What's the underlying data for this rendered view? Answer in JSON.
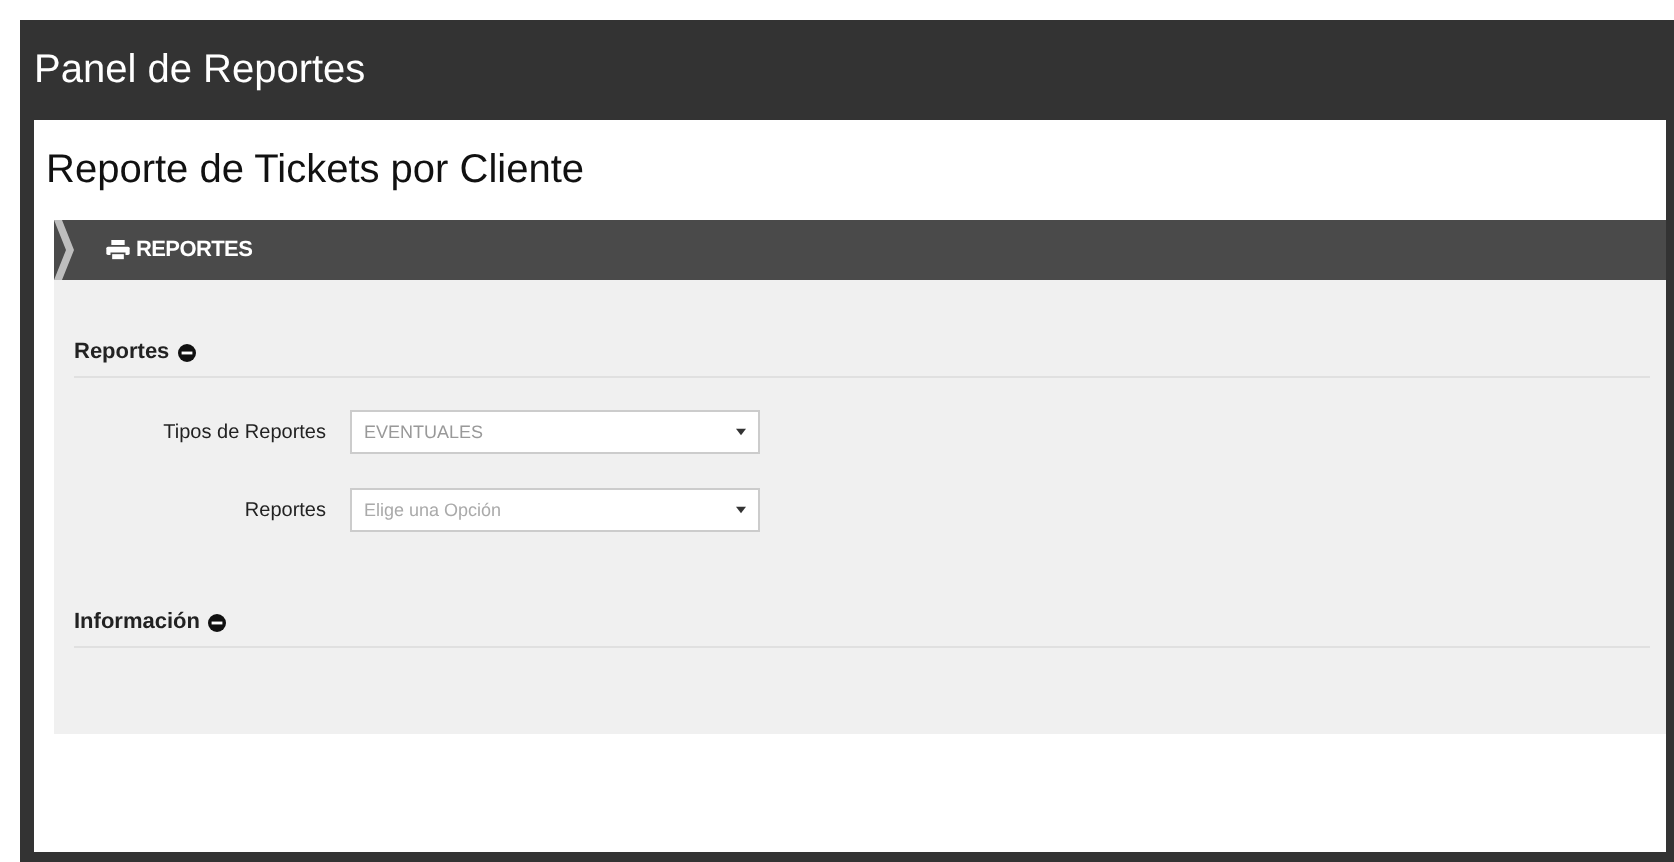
{
  "window": {
    "title": "Panel de Reportes"
  },
  "page_title": "Reporte de Tickets por Cliente",
  "section_bar": {
    "label": "REPORTES"
  },
  "sections": [
    {
      "title": "Reportes",
      "expanded": true,
      "fields": [
        {
          "label": "Tipos de Reportes",
          "value": "EVENTUALES"
        },
        {
          "label": "Reportes",
          "placeholder": "Elige una Opción"
        }
      ]
    },
    {
      "title": "Información",
      "expanded": true
    }
  ]
}
